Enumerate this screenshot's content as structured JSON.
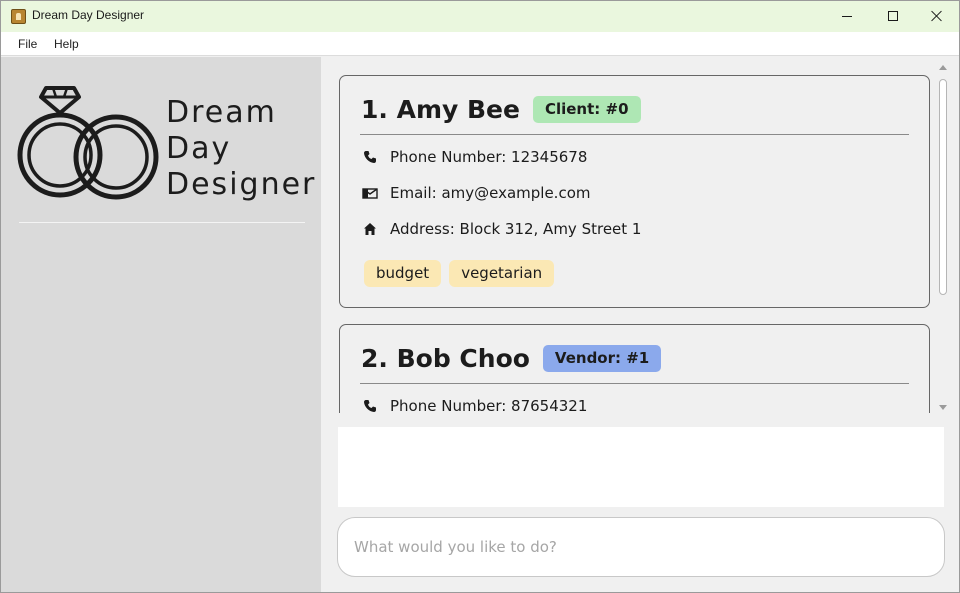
{
  "window": {
    "title": "Dream Day Designer"
  },
  "menu": {
    "items": [
      "File",
      "Help"
    ]
  },
  "sidebar": {
    "logo_lines": [
      "Dream",
      "Day",
      "Designer"
    ]
  },
  "persons": [
    {
      "index_name": "1. Amy Bee",
      "role_label": "Client: #0",
      "phone": "Phone Number: 12345678",
      "email": "Email: amy@example.com",
      "address": "Address: Block 312, Amy Street 1",
      "tags": [
        "budget",
        "vegetarian"
      ]
    },
    {
      "index_name": "2. Bob Choo",
      "role_label": "Vendor: #1",
      "phone": "Phone Number: 87654321"
    }
  ],
  "result": {
    "text": ""
  },
  "command": {
    "placeholder": "What would you like to do?"
  },
  "colors": {
    "titlebar_bg": "#eaf7de",
    "sidebar_bg": "#dadada",
    "client_badge": "#aee7b4",
    "vendor_badge": "#8ba9ec",
    "tag_bg": "#fbe8b4"
  },
  "icons": {
    "app": "app-icon",
    "phone": "phone-icon",
    "email": "email-icon",
    "address": "home-icon",
    "logo": "wedding-rings-icon"
  }
}
